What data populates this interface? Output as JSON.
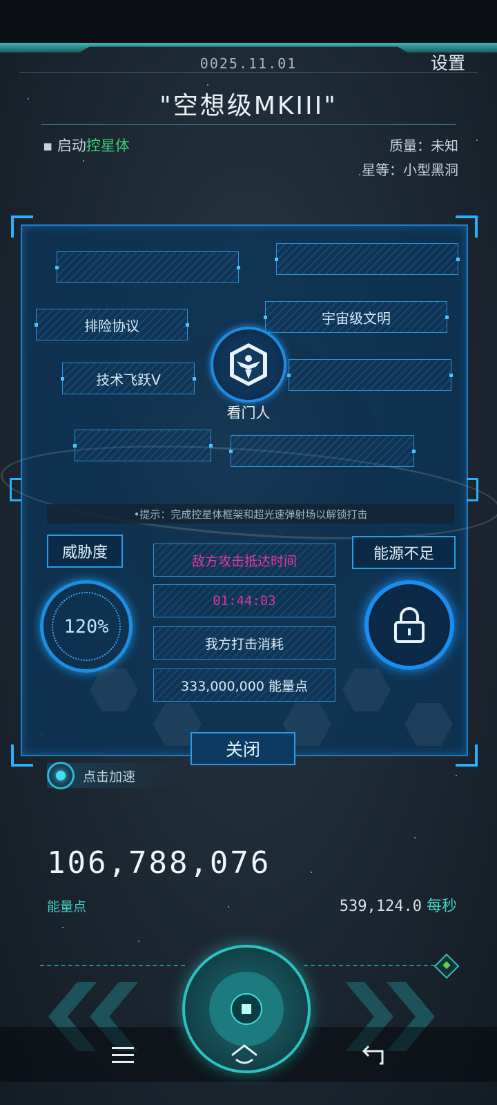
{
  "header": {
    "date": "0025.11.01",
    "settings_label": "设置",
    "title": "\"空想级MKIII\"",
    "launch_prefix": "启动",
    "launch_highlight": "控星体",
    "mass": "质量：未知",
    "rank": "星等：小型黑洞"
  },
  "panel": {
    "tech_nodes": [
      "",
      "",
      "排险协议",
      "宇宙级文明",
      "技术飞跃V",
      "",
      "",
      ""
    ],
    "emblem_label": "看门人",
    "hint": "•提示：完成控星体框架和超光速弹射场以解锁打击",
    "threat_label": "威胁度",
    "threat_value": "120%",
    "energy_status": "能源不足",
    "info": {
      "arrival_label": "敌方攻击抵达时间",
      "arrival_time": "01:44:03",
      "cost_label": "我方打击消耗",
      "cost_value": "333,000,000 能量点"
    },
    "close_label": "关闭"
  },
  "speed_up_label": "点击加速",
  "resources": {
    "energy_total": "106,788,076",
    "energy_label": "能量点",
    "rate_value": "539,124.0",
    "rate_unit": "每秒"
  },
  "icons": {
    "emblem": "eagle-emblem-icon",
    "lock": "lock-icon",
    "nav": [
      "menu-icon",
      "home-icon",
      "back-icon"
    ]
  },
  "colors": {
    "panel_border": "#1e7fc8",
    "highlight_green": "#39d27e",
    "teal": "#43d2c6",
    "pink": "#e3389b"
  }
}
